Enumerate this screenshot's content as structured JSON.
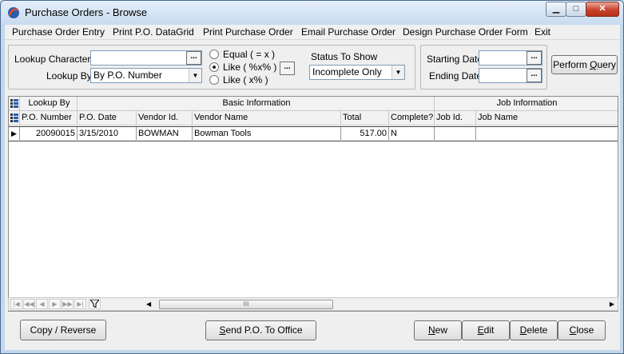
{
  "window": {
    "title": "Purchase Orders - Browse",
    "caption_min": "▁",
    "caption_max": "□",
    "caption_close": "✕"
  },
  "menu": [
    "Purchase Order Entry",
    "Print P.O. DataGrid",
    "Print Purchase Order",
    "Email Purchase Order",
    "Design Purchase Order Form",
    "Exit"
  ],
  "lookup": {
    "characters_label": "Lookup Characters",
    "characters_value": "",
    "lookup_by_label": "Lookup By",
    "lookup_by_value": "By P.O. Number",
    "ellipsis": "..."
  },
  "match_mode": {
    "options": [
      "Equal ( = x )",
      "Like ( %x% )",
      "Like ( x% )"
    ],
    "selected_index": 1,
    "ellipsis": "..."
  },
  "status": {
    "label": "Status To Show",
    "value": "Incomplete Only"
  },
  "dates": {
    "starting_label": "Starting Date",
    "starting_value": "",
    "ending_label": "Ending Date",
    "ending_value": "",
    "ellipsis": "..."
  },
  "perform_query": {
    "pre": "Perform ",
    "u": "Q",
    "post": "uery"
  },
  "grid": {
    "group_headers": [
      "Lookup By",
      "Basic Information",
      "Job Information"
    ],
    "columns": [
      "P.O. Number",
      "P.O. Date",
      "Vendor Id.",
      "Vendor Name",
      "Total",
      "Complete?",
      "Job Id.",
      "Job Name"
    ],
    "rows": [
      [
        "20090015",
        "3/15/2010",
        "BOWMAN",
        "Bowman Tools",
        "517.00",
        "N",
        "",
        ""
      ]
    ]
  },
  "nav": [
    "|◀",
    "◀◀",
    "◀",
    "▶",
    "▶▶",
    "▶|"
  ],
  "scroll": {
    "left": "◀",
    "right": "▶",
    "thumb": "III"
  },
  "buttons": {
    "copy_reverse": "Copy / Reverse",
    "send_po": {
      "u": "S",
      "rest": "end P.O. To Office"
    },
    "new": {
      "u": "N",
      "rest": "ew"
    },
    "edit": {
      "u": "E",
      "rest": "dit"
    },
    "delete": {
      "u": "D",
      "rest": "elete"
    },
    "close": {
      "u": "C",
      "rest": "lose"
    }
  },
  "colors": {
    "accent": "#4a6a8e",
    "close_red": "#c7432d",
    "grid_border": "#8a8a8a"
  }
}
